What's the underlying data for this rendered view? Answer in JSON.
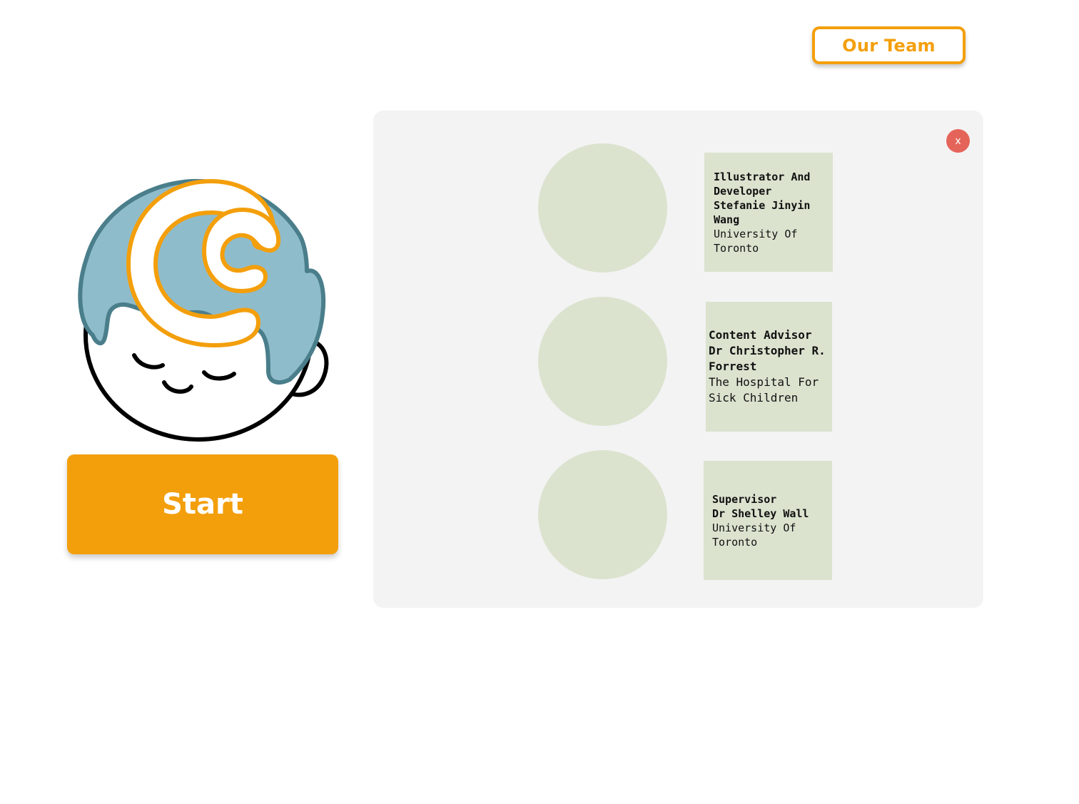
{
  "header": {
    "team_button_label": "Our Team"
  },
  "main": {
    "start_button_label": "Start",
    "logo_icon": "sleeping-baby-logo-icon"
  },
  "team_panel": {
    "close_label": "x",
    "members": [
      {
        "role": "Illustrator And Developer",
        "name": "Stefanie Jinyin Wang",
        "affiliation": "University Of Toronto"
      },
      {
        "role": "Content Advisor",
        "name": "Dr Christopher R. Forrest",
        "affiliation": "The Hospital For Sick Children"
      },
      {
        "role": "Supervisor",
        "name": "Dr Shelley Wall",
        "affiliation": "University Of Toronto"
      }
    ]
  },
  "colors": {
    "accent": "#f39f0c",
    "close": "#e5645a",
    "card": "#dbe3cf",
    "panel": "#f3f3f3",
    "hair": "#8fbccb",
    "hair_outline": "#4a7e8b"
  }
}
